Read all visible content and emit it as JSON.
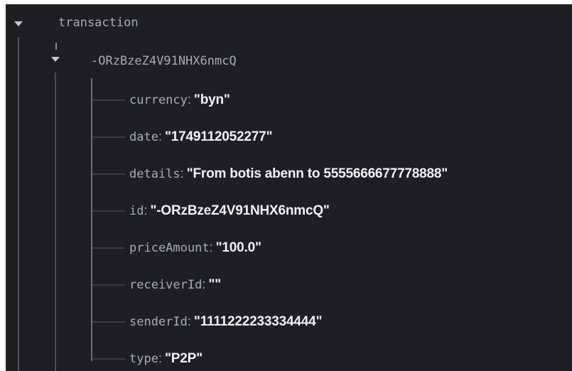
{
  "tree": {
    "root": {
      "label": "transaction",
      "child": {
        "label": "-ORzBzeZ4V91NHX6nmcQ",
        "fields": [
          {
            "key": "currency",
            "value": "\"byn\""
          },
          {
            "key": "date",
            "value": "\"1749112052277\""
          },
          {
            "key": "details",
            "value": "\"From botis abenn to 5555666677778888\""
          },
          {
            "key": "id",
            "value": "\"-ORzBzeZ4V91NHX6nmcQ\""
          },
          {
            "key": "priceAmount",
            "value": "\"100.0\""
          },
          {
            "key": "receiverId",
            "value": "\"\""
          },
          {
            "key": "senderId",
            "value": "\"1111222233334444\""
          },
          {
            "key": "type",
            "value": "\"P2P\""
          }
        ]
      }
    }
  },
  "separator": ":",
  "icons": {
    "expand": "chevron-down-icon"
  },
  "colors": {
    "background": "#1e1f22",
    "key_text": "#a9abb3",
    "value_text": "#f1f2f4",
    "tree_line": "#6b6e75"
  }
}
